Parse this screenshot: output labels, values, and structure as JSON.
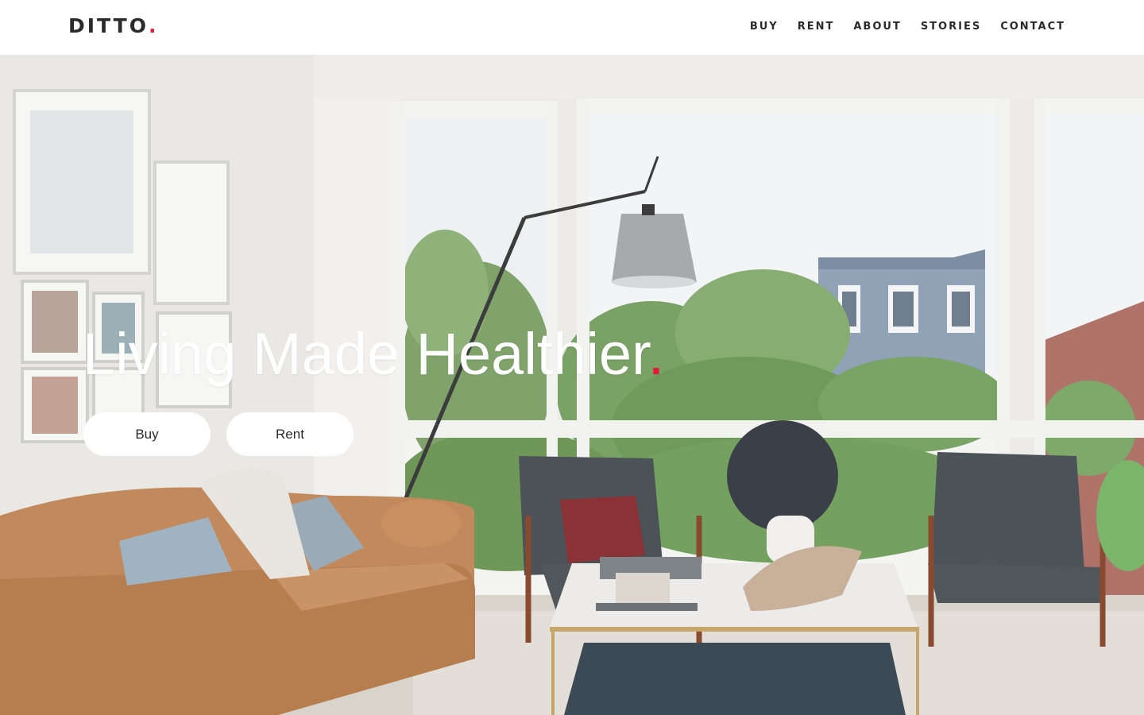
{
  "brand": {
    "name": "DITTO",
    "dot": ".",
    "accent_color": "#e8163a"
  },
  "nav": {
    "items": [
      {
        "label": "BUY"
      },
      {
        "label": "RENT"
      },
      {
        "label": "ABOUT"
      },
      {
        "label": "STORIES"
      },
      {
        "label": "CONTACT"
      }
    ]
  },
  "hero": {
    "headline": "Living Made Healthier",
    "headline_dot": ".",
    "buttons": {
      "buy_label": "Buy",
      "rent_label": "Rent"
    }
  }
}
